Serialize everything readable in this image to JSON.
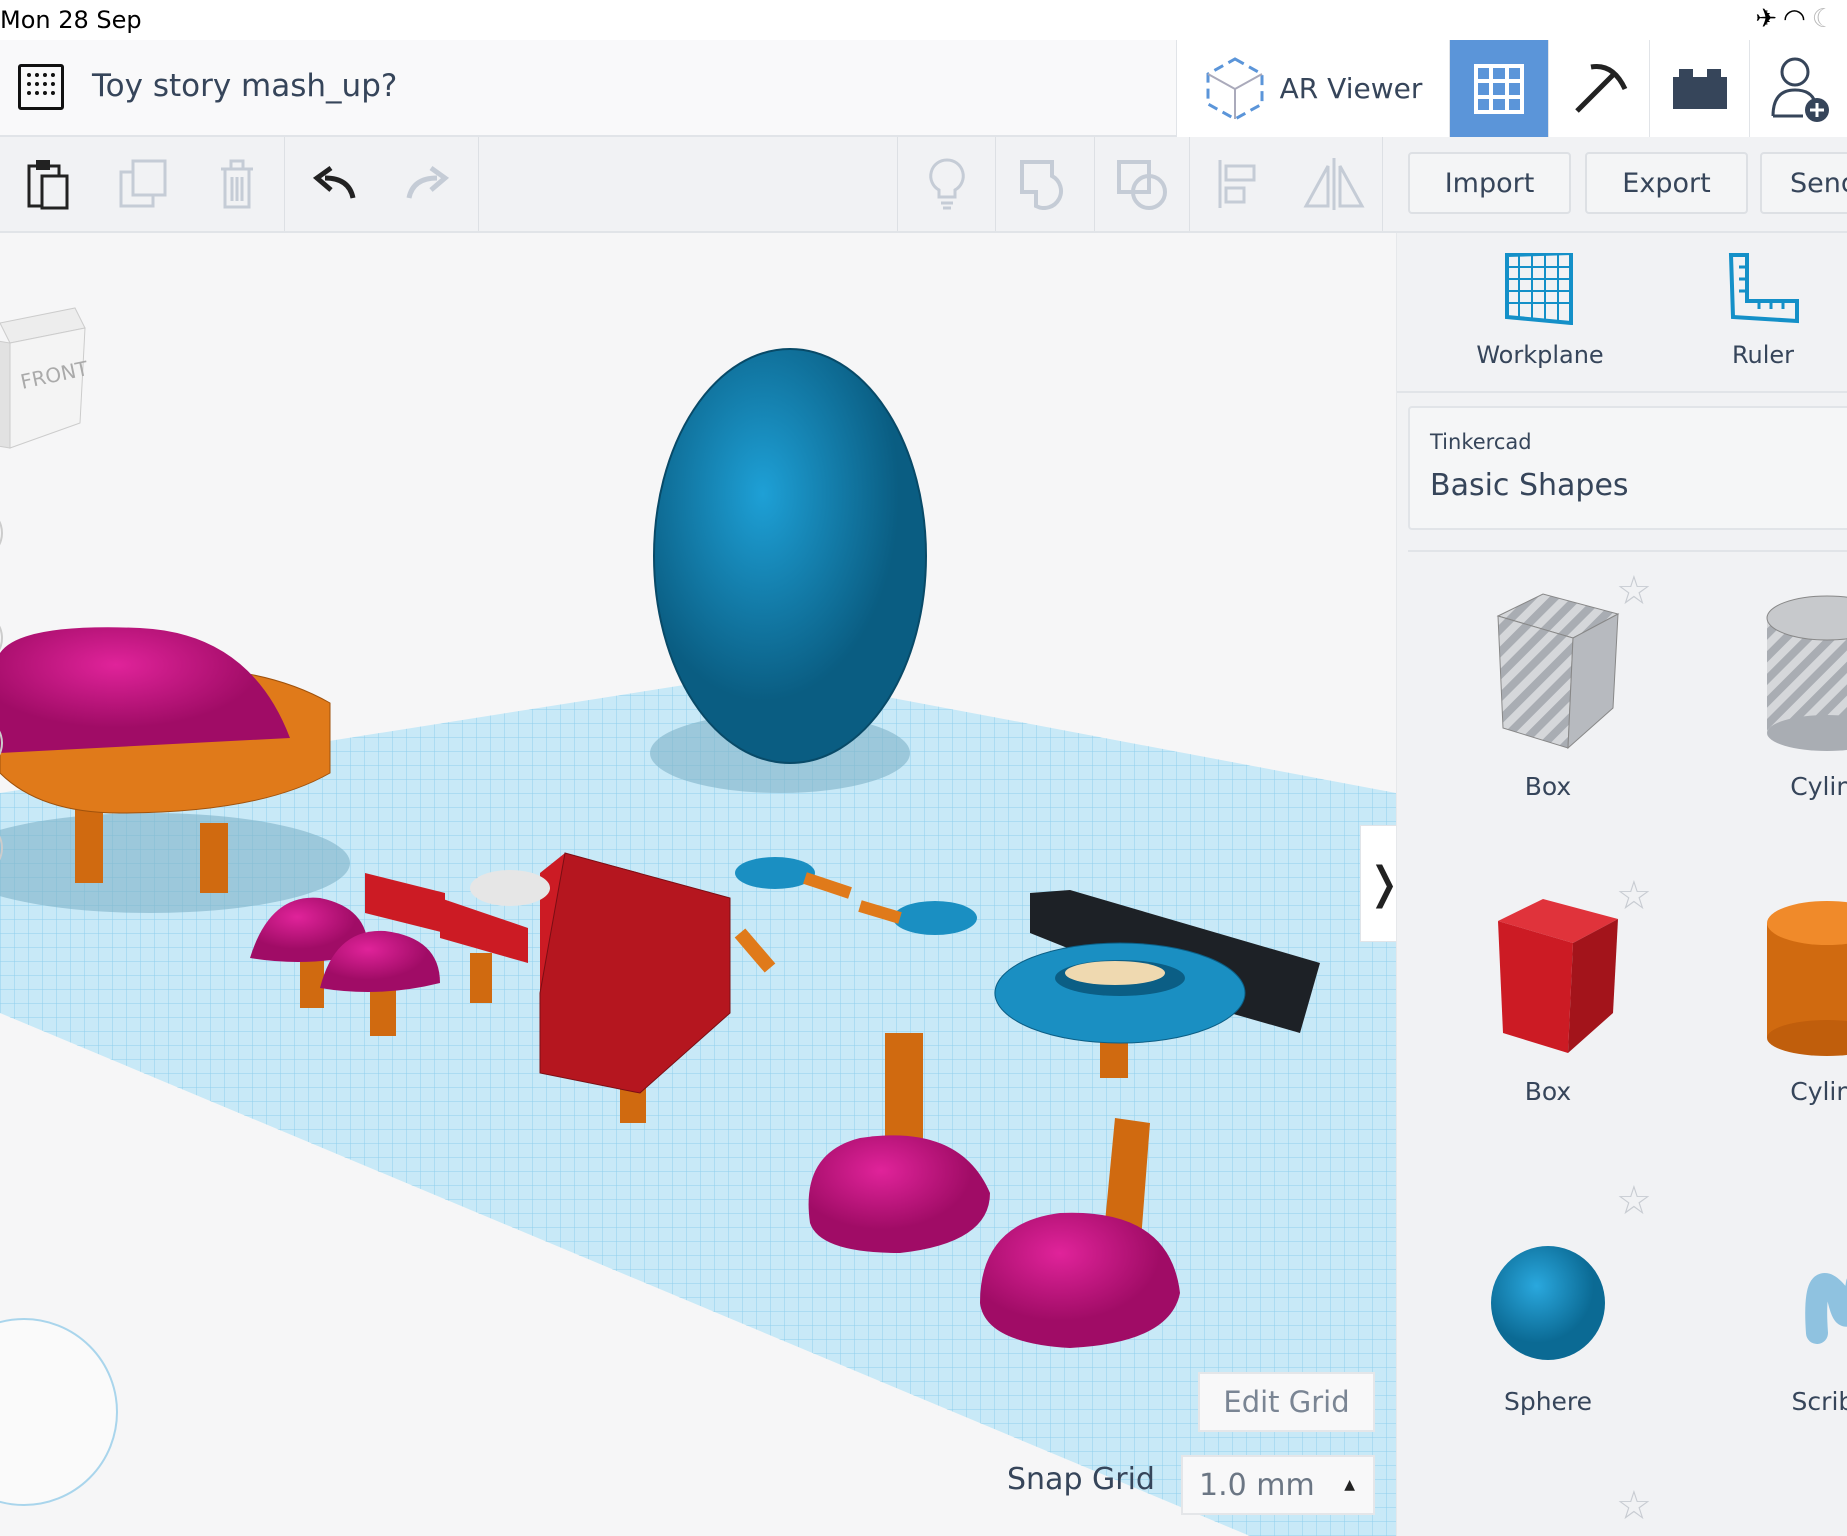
{
  "status_bar": {
    "time": "Mon 28 Sep",
    "icons": [
      "airplane-icon",
      "wifi-icon",
      "moon-icon"
    ]
  },
  "header": {
    "title": "Toy story mash_up?",
    "ar_viewer": "AR Viewer"
  },
  "toolbar": {
    "import": "Import",
    "export": "Export",
    "send": "Send"
  },
  "panel": {
    "workplane": "Workplane",
    "ruler": "Ruler",
    "library_source": "Tinkercad",
    "library_name": "Basic Shapes",
    "shapes": [
      {
        "label": "Box",
        "style": "striped"
      },
      {
        "label": "Cylinder",
        "style": "striped"
      },
      {
        "label": "Box",
        "color": "#cc1b24"
      },
      {
        "label": "Cylinder",
        "color": "#e07a1a"
      },
      {
        "label": "Sphere",
        "color": "#1a8fc2"
      },
      {
        "label": "Scribble",
        "color": "#8fc2e0"
      }
    ]
  },
  "viewcube": {
    "front": "FRONT"
  },
  "canvas": {
    "edit_grid": "Edit Grid",
    "snap_grid_label": "Snap Grid",
    "snap_grid_value": "1.0 mm"
  },
  "colors": {
    "accent": "#5b95d9",
    "magenta": "#c9107f",
    "orange": "#e07a1a",
    "blue": "#1a8fc2",
    "red": "#cc1b24"
  }
}
